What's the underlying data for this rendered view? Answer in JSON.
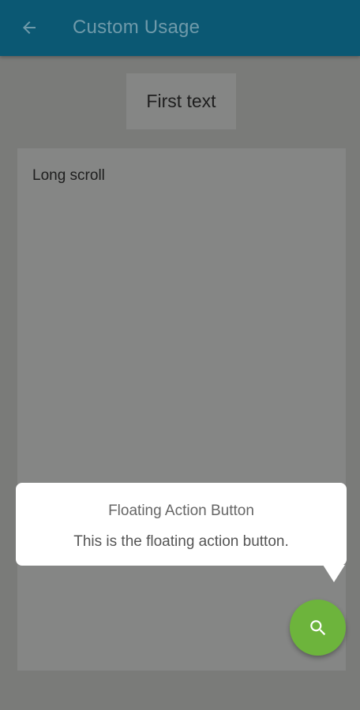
{
  "appbar": {
    "title": "Custom Usage",
    "back_icon": "arrow-back-icon",
    "background": "#0b5873"
  },
  "main": {
    "first_text": "First text",
    "scroll_label": "Long scroll"
  },
  "tooltip": {
    "title": "Floating Action Button",
    "description": "This is the floating action button."
  },
  "fab": {
    "icon": "search-icon",
    "color": "#6db43c"
  }
}
